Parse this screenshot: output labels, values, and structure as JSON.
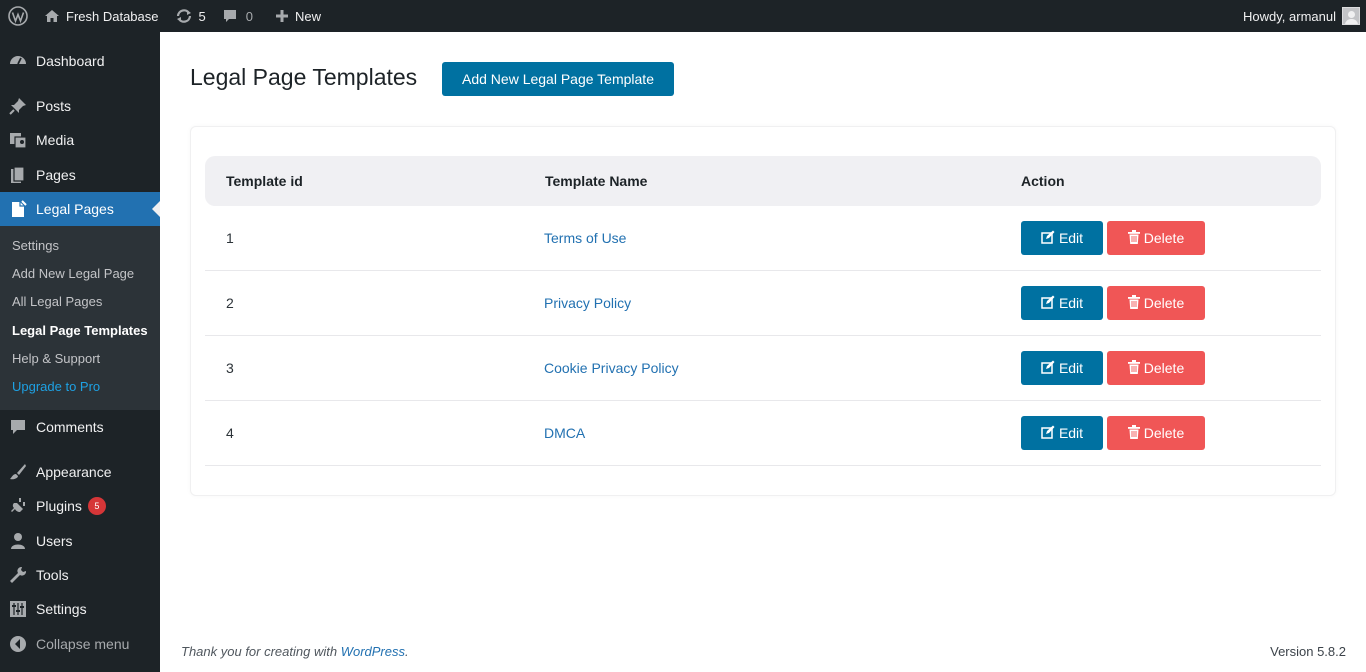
{
  "adminbar": {
    "site_name": "Fresh Database",
    "updates_count": "5",
    "comments_count": "0",
    "new_label": "New",
    "howdy": "Howdy, armanul"
  },
  "sidebar": {
    "items": [
      {
        "label": "Dashboard",
        "icon": "dashboard-icon"
      },
      {
        "label": "Posts",
        "icon": "pin-icon"
      },
      {
        "label": "Media",
        "icon": "media-icon"
      },
      {
        "label": "Pages",
        "icon": "pages-icon"
      },
      {
        "label": "Legal Pages",
        "icon": "document-icon"
      },
      {
        "label": "Comments",
        "icon": "comment-icon"
      },
      {
        "label": "Appearance",
        "icon": "brush-icon"
      },
      {
        "label": "Plugins",
        "icon": "plug-icon",
        "badge": "5"
      },
      {
        "label": "Users",
        "icon": "user-icon"
      },
      {
        "label": "Tools",
        "icon": "wrench-icon"
      },
      {
        "label": "Settings",
        "icon": "sliders-icon"
      },
      {
        "label": "Collapse menu",
        "icon": "collapse-icon"
      }
    ],
    "submenu": [
      "Settings",
      "Add New Legal Page",
      "All Legal Pages",
      "Legal Page Templates",
      "Help & Support",
      "Upgrade to Pro"
    ]
  },
  "main": {
    "title": "Legal Page Templates",
    "add_button": "Add New Legal Page Template",
    "table": {
      "headers": [
        "Template id",
        "Template Name",
        "Action"
      ],
      "rows": [
        {
          "id": "1",
          "name": "Terms of Use"
        },
        {
          "id": "2",
          "name": "Privacy Policy"
        },
        {
          "id": "3",
          "name": "Cookie Privacy Policy"
        },
        {
          "id": "4",
          "name": "DMCA"
        }
      ],
      "edit_label": "Edit",
      "delete_label": "Delete"
    }
  },
  "footer": {
    "thanks_prefix": "Thank you for creating with ",
    "thanks_link": "WordPress",
    "thanks_suffix": ".",
    "version": "Version 5.8.2"
  },
  "colors": {
    "accent": "#0071a1",
    "delete": "#f05656",
    "sidebar_bg": "#1d2327",
    "current_menu": "#2271b1",
    "upgrade_link": "#1ea1e3"
  }
}
